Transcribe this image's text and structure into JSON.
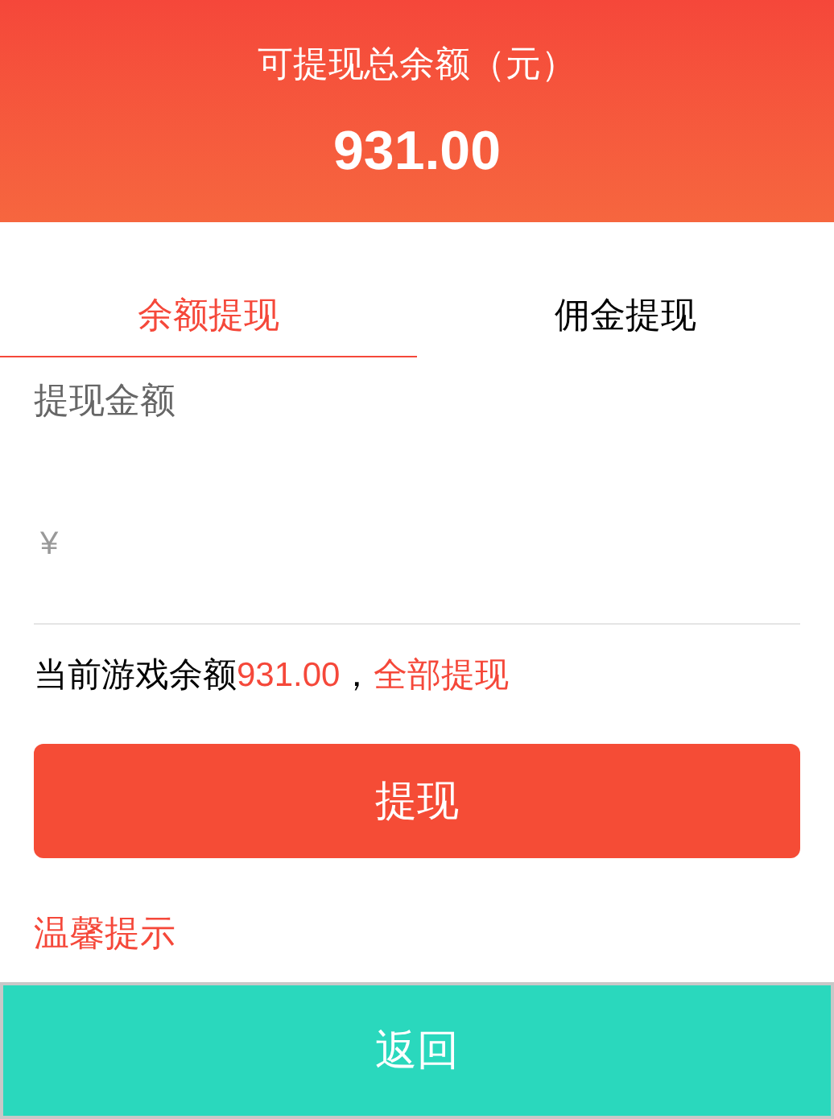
{
  "header": {
    "title": "可提现总余额（元）",
    "amount": "931.00"
  },
  "tabs": [
    {
      "label": "余额提现",
      "selected": true
    },
    {
      "label": "佣金提现",
      "selected": false
    }
  ],
  "amount_field": {
    "label": "提现金额",
    "currency": "¥"
  },
  "balance_line": {
    "prefix": "当前游戏余额",
    "amount": "931.00",
    "separator": "，",
    "link": "全部提现"
  },
  "submit_button": "提现",
  "tips_title": "温馨提示",
  "bottom_bar": {
    "button": "返回"
  }
}
